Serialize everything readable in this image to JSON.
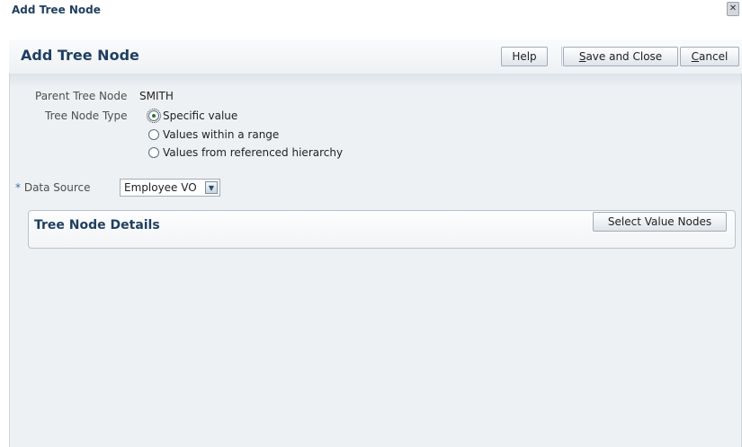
{
  "dialog": {
    "title": "Add Tree Node",
    "close_symbol": "✕"
  },
  "header": {
    "title": "Add Tree Node",
    "help_label": "Help",
    "save_label_mnemonic": "S",
    "save_label_rest": "ave and Close",
    "cancel_label_mnemonic": "C",
    "cancel_label_rest": "ancel"
  },
  "form": {
    "parent_label": "Parent Tree Node",
    "parent_value": "SMITH",
    "type_label": "Tree Node Type",
    "type_options": [
      {
        "label": "Specific value",
        "selected": true
      },
      {
        "label": "Values within a range",
        "selected": false
      },
      {
        "label": "Values from referenced hierarchy",
        "selected": false
      }
    ],
    "required_marker": "*",
    "datasource_label": "Data Source",
    "datasource_value": "Employee VO",
    "dropdown_arrow": "▼"
  },
  "details": {
    "title": "Tree Node Details",
    "select_button": "Select Value Nodes"
  }
}
